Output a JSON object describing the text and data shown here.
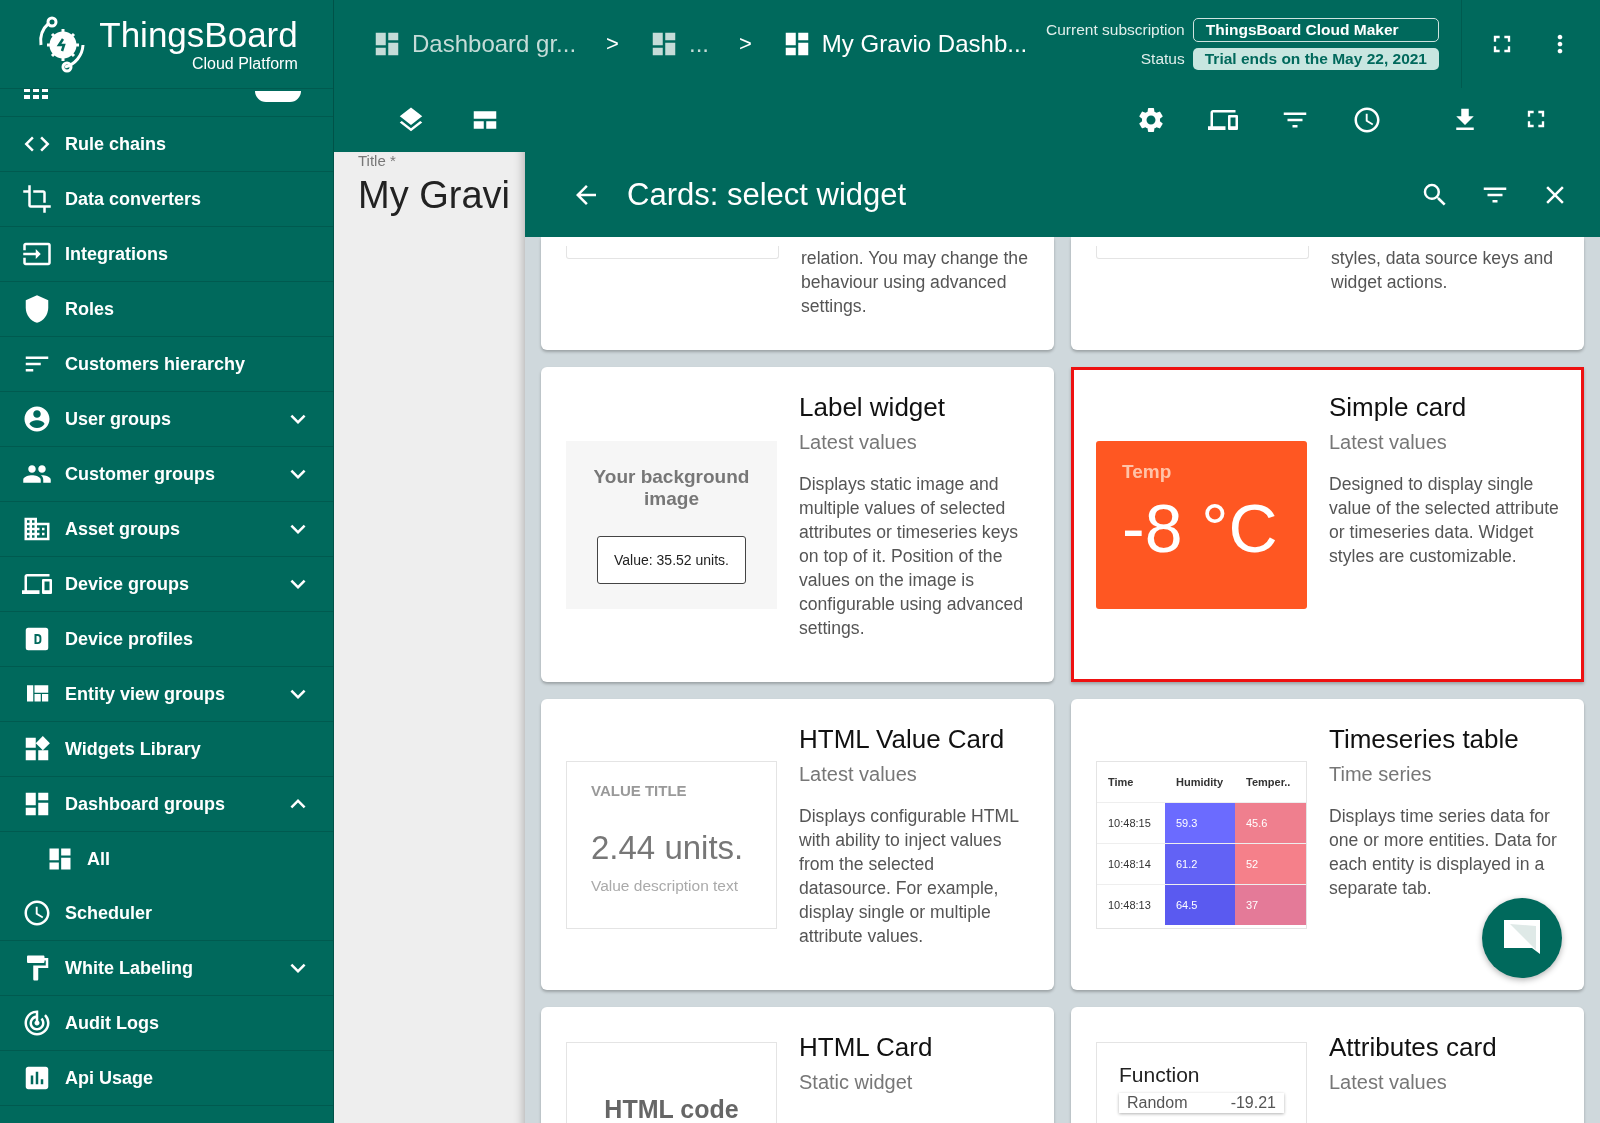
{
  "sidebar": {
    "logo": {
      "name": "ThingsBoard",
      "subtitle": "Cloud Platform"
    },
    "items": [
      {
        "badge": true
      },
      {
        "label": "Rule chains"
      },
      {
        "label": "Data converters"
      },
      {
        "label": "Integrations"
      },
      {
        "label": "Roles"
      },
      {
        "label": "Customers hierarchy"
      },
      {
        "label": "User groups",
        "expanded": false
      },
      {
        "label": "Customer groups",
        "expanded": false
      },
      {
        "label": "Asset groups",
        "expanded": false
      },
      {
        "label": "Device groups",
        "expanded": false
      },
      {
        "label": "Device profiles"
      },
      {
        "label": "Entity view groups",
        "expanded": false
      },
      {
        "label": "Widgets Library"
      },
      {
        "label": "Dashboard groups",
        "expanded": true,
        "children": [
          {
            "label": "All"
          }
        ]
      },
      {
        "label": "Scheduler"
      },
      {
        "label": "White Labeling",
        "expanded": false
      },
      {
        "label": "Audit Logs"
      },
      {
        "label": "Api Usage"
      }
    ]
  },
  "topbar": {
    "breadcrumbs": [
      {
        "kind": "crumb",
        "label": "Dashboard gr...",
        "current": false
      },
      {
        "kind": "separator",
        "label": ">"
      },
      {
        "kind": "crumb",
        "label": "...",
        "current": false
      },
      {
        "kind": "separator",
        "label": ">"
      },
      {
        "kind": "crumb",
        "label": "My Gravio Dashb...",
        "current": true
      }
    ],
    "subscription": [
      {
        "label": "Current subscription",
        "value": "ThingsBoard Cloud Maker",
        "kind": "outline"
      },
      {
        "label": "Status",
        "value": "Trial ends on the May 22, 2021",
        "kind": "filled"
      }
    ]
  },
  "dashboard": {
    "title_label": "Title *",
    "title": "My Gravi"
  },
  "drawer": {
    "title": "Cards: select widget",
    "cards": [
      {
        "kind": "partial",
        "selected": false,
        "description": "relation. You may change the behaviour using advanced settings."
      },
      {
        "kind": "partial",
        "selected": false,
        "description": "styles, data source keys and widget actions."
      },
      {
        "kind": "full",
        "selected": false,
        "title": "Label widget",
        "type": "Latest values",
        "description": "Displays static image and multiple values of selected attributes or timeseries keys on top of it. Position of the values on the image is configurable using advanced settings.",
        "preview": {
          "kind": "label",
          "heading": "Your background image",
          "value": "Value: 35.52 units."
        }
      },
      {
        "kind": "full",
        "selected": true,
        "title": "Simple card",
        "type": "Latest values",
        "description": "Designed to display single value of the selected attribute or timeseries data. Widget styles are customizable.",
        "preview": {
          "kind": "simple",
          "label": "Temp",
          "value": "-8 °C"
        }
      },
      {
        "kind": "full",
        "selected": false,
        "title": "HTML Value Card",
        "type": "Latest values",
        "description": "Displays configurable HTML with ability to inject values from the selected datasource. For example, display single or multiple attribute values.",
        "preview": {
          "kind": "value",
          "heading": "VALUE TITLE",
          "value": "2.44 units.",
          "note": "Value description text"
        }
      },
      {
        "kind": "full",
        "selected": false,
        "title": "Timeseries table",
        "type": "Time series",
        "description": "Displays time series data for one or more entities. Data for each entity is displayed in a separate tab.",
        "preview": {
          "kind": "table",
          "columns": [
            "Time",
            "Humidity",
            "Temper.."
          ],
          "rows": [
            [
              "10:48:15",
              "59.3",
              "45.6"
            ],
            [
              "10:48:14",
              "61.2",
              "52"
            ],
            [
              "10:48:13",
              "64.5",
              "37"
            ]
          ]
        }
      },
      {
        "kind": "full",
        "selected": false,
        "title": "HTML Card",
        "type": "Static widget",
        "preview": {
          "kind": "html",
          "heading": "HTML code"
        }
      },
      {
        "kind": "full",
        "selected": false,
        "title": "Attributes card",
        "type": "Latest values",
        "preview": {
          "kind": "attributes",
          "heading": "Function",
          "key": "Random",
          "value": "-19.21"
        }
      }
    ]
  }
}
